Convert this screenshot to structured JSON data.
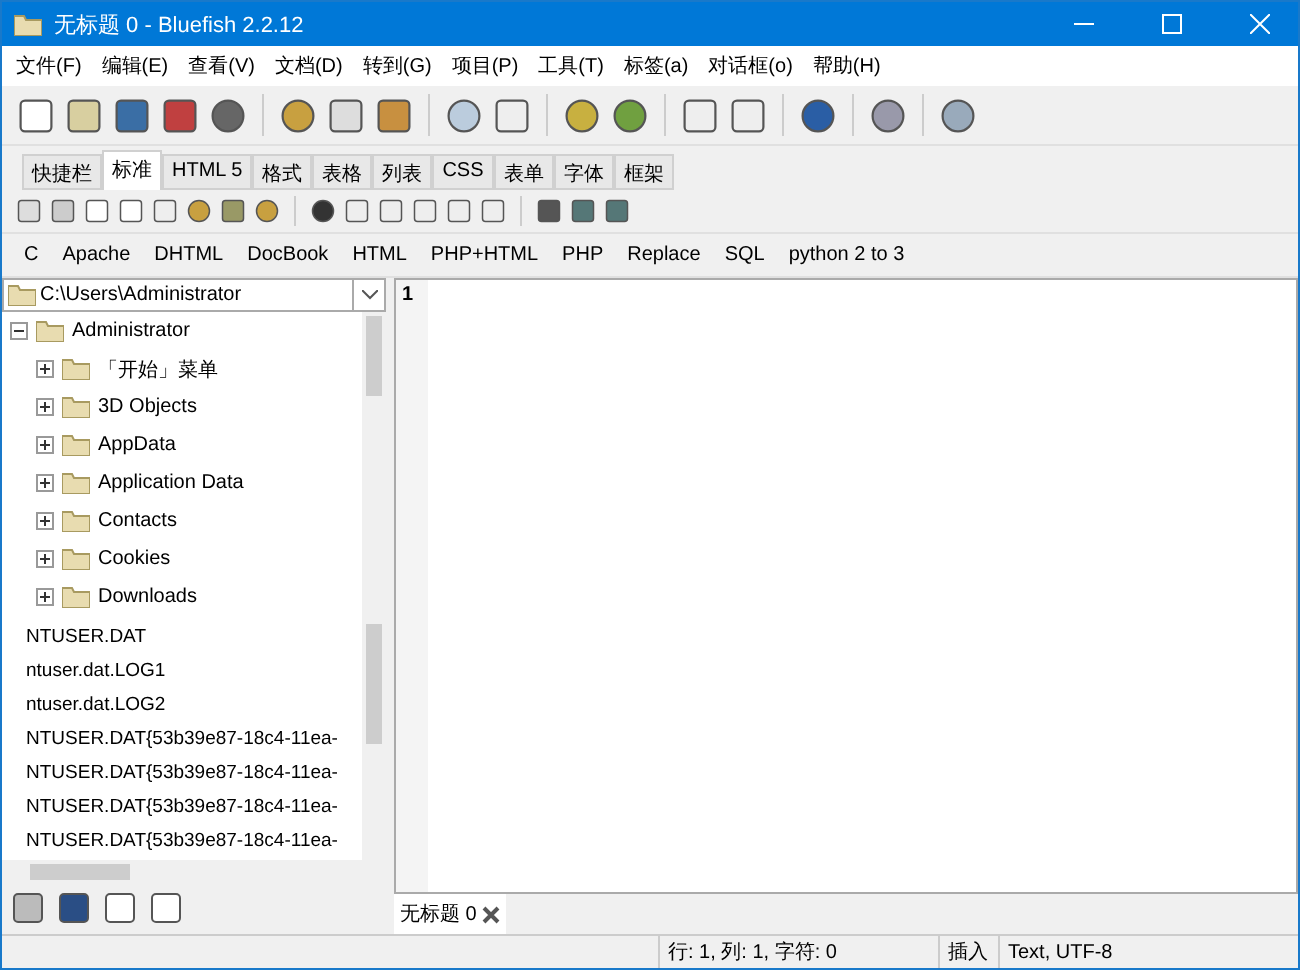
{
  "window": {
    "title": "无标题 0 - Bluefish 2.2.12"
  },
  "menu": [
    "文件(F)",
    "编辑(E)",
    "查看(V)",
    "文档(D)",
    "转到(G)",
    "项目(P)",
    "工具(T)",
    "标签(a)",
    "对话框(o)",
    "帮助(H)"
  ],
  "tabs": [
    {
      "label": "快捷栏",
      "selected": false
    },
    {
      "label": "标准",
      "selected": true
    },
    {
      "label": "HTML 5",
      "selected": false
    },
    {
      "label": "格式",
      "selected": false
    },
    {
      "label": "表格",
      "selected": false
    },
    {
      "label": "列表",
      "selected": false
    },
    {
      "label": "CSS",
      "selected": false
    },
    {
      "label": "表单",
      "selected": false
    },
    {
      "label": "字体",
      "selected": false
    },
    {
      "label": "框架",
      "selected": false
    }
  ],
  "snippets": [
    "C",
    "Apache",
    "DHTML",
    "DocBook",
    "HTML",
    "PHP+HTML",
    "PHP",
    "Replace",
    "SQL",
    "python 2 to 3"
  ],
  "path_field": {
    "value": "C:\\Users\\Administrator"
  },
  "tree": [
    {
      "label": "Administrator",
      "expanded": true,
      "children": [
        {
          "label": "「开始」菜单",
          "expanded": false
        },
        {
          "label": "3D Objects",
          "expanded": false
        },
        {
          "label": "AppData",
          "expanded": false
        },
        {
          "label": "Application Data",
          "expanded": false
        },
        {
          "label": "Contacts",
          "expanded": false
        },
        {
          "label": "Cookies",
          "expanded": false
        },
        {
          "label": "Downloads",
          "expanded": false
        }
      ]
    }
  ],
  "files": [
    "NTUSER.DAT",
    "ntuser.dat.LOG1",
    "ntuser.dat.LOG2",
    "NTUSER.DAT{53b39e87-18c4-11ea-",
    "NTUSER.DAT{53b39e87-18c4-11ea-",
    "NTUSER.DAT{53b39e87-18c4-11ea-",
    "NTUSER.DAT{53b39e87-18c4-11ea-"
  ],
  "editor": {
    "line_number": "1"
  },
  "document_tab": {
    "label": "无标题 0"
  },
  "status_bar": {
    "position": "行: 1, 列: 1, 字符: 0",
    "mode": "插入",
    "encoding": "Text, UTF-8"
  }
}
